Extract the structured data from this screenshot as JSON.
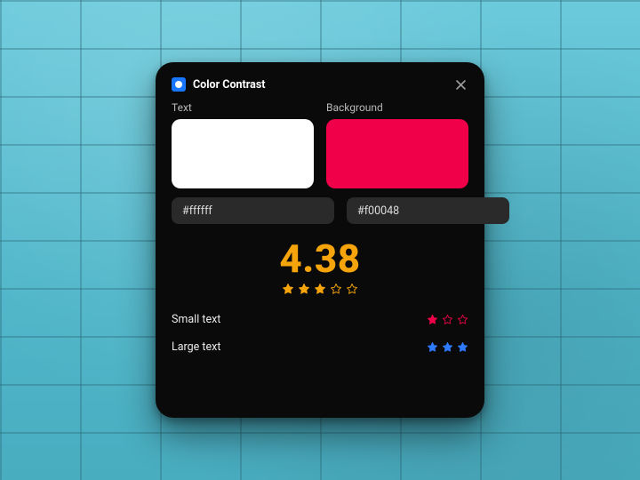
{
  "app": {
    "title": "Color Contrast"
  },
  "labels": {
    "text": "Text",
    "background": "Background"
  },
  "colors": {
    "text_hex": "#ffffff",
    "background_hex": "#f00048"
  },
  "score": {
    "value": "4.38",
    "color": "#f5a40b",
    "stars_filled": 3,
    "stars_total": 5
  },
  "rows": {
    "small": {
      "label": "Small text",
      "stars_filled": 1,
      "stars_total": 3,
      "star_color": "#f00048"
    },
    "large": {
      "label": "Large text",
      "stars_filled": 3,
      "stars_total": 3,
      "star_color": "#2f7bff"
    }
  }
}
